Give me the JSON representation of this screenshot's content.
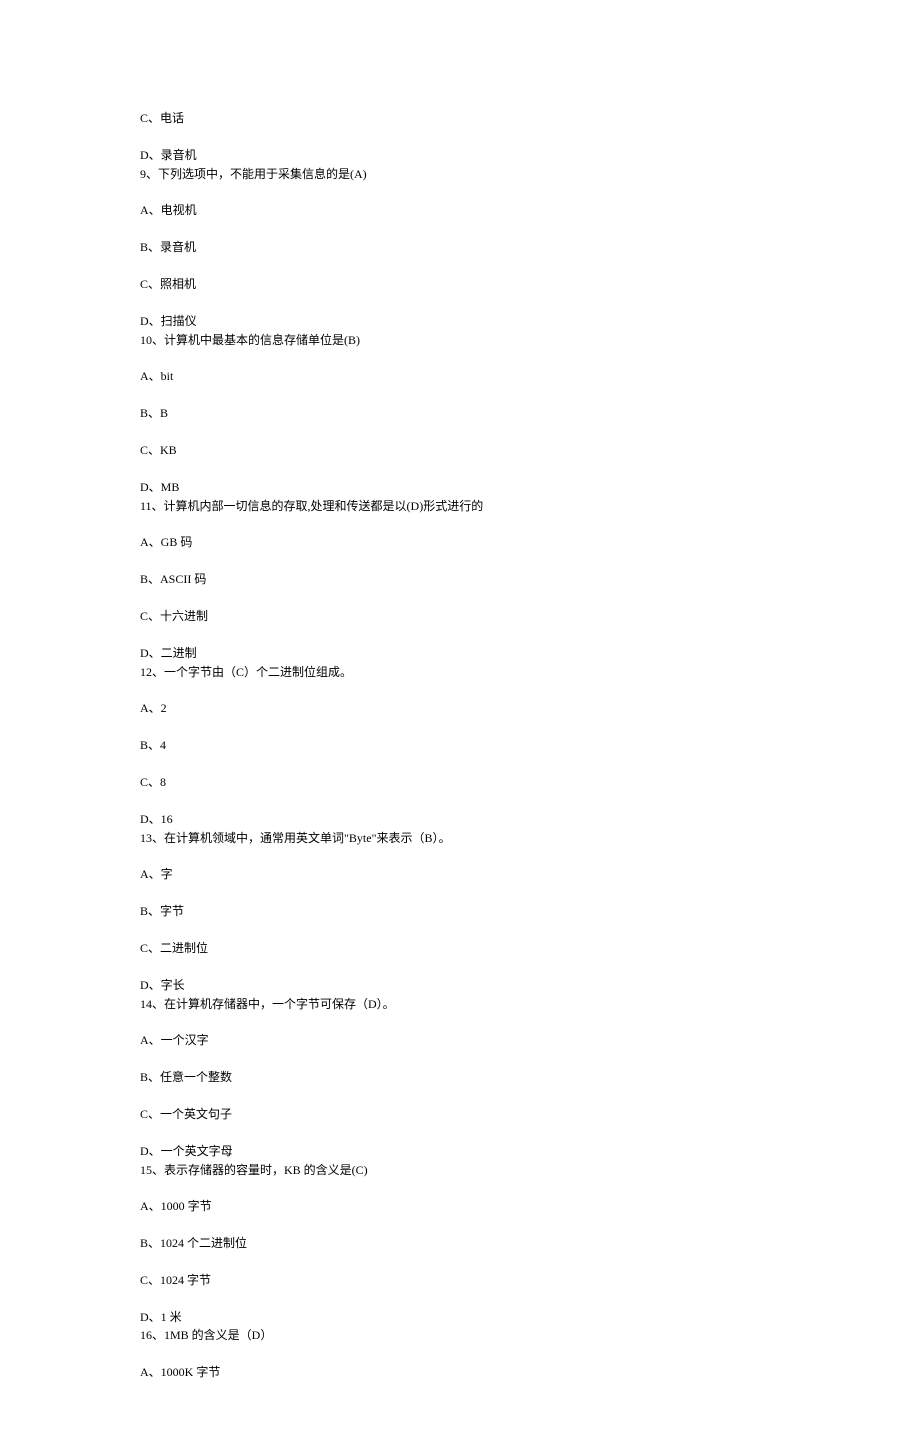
{
  "lines": [
    "C、电话",
    "",
    "D、录音机",
    "9、下列选项中，不能用于采集信息的是(A)",
    "",
    "A、电视机",
    "",
    "B、录音机",
    "",
    "C、照相机",
    "",
    "D、扫描仪",
    "10、计算机中最基本的信息存储单位是(B)",
    "",
    "A、bit",
    "",
    "B、B",
    "",
    "C、KB",
    "",
    "D、MB",
    "11、计算机内部一切信息的存取,处理和传送都是以(D)形式进行的",
    "",
    "A、GB 码",
    "",
    "B、ASCII 码",
    "",
    "C、十六进制",
    "",
    "D、二进制",
    "12、一个字节由（C）个二进制位组成。",
    "",
    "A、2",
    "",
    "B、4",
    "",
    "C、8",
    "",
    "D、16",
    "13、在计算机领域中，通常用英文单词\"Byte\"来表示（B）。",
    "",
    "A、字",
    "",
    "B、字节",
    "",
    "C、二进制位",
    "",
    "D、字长",
    "14、在计算机存储器中，一个字节可保存（D）。",
    "",
    "A、一个汉字",
    "",
    "B、任意一个整数",
    "",
    "C、一个英文句子",
    "",
    "D、一个英文字母",
    "15、表示存储器的容量时，KB 的含义是(C)",
    "",
    "A、1000 字节",
    "",
    "B、1024 个二进制位",
    "",
    "C、1024 字节",
    "",
    "D、1 米",
    "16、1MB 的含义是（D）",
    "",
    "A、1000K 字节"
  ]
}
